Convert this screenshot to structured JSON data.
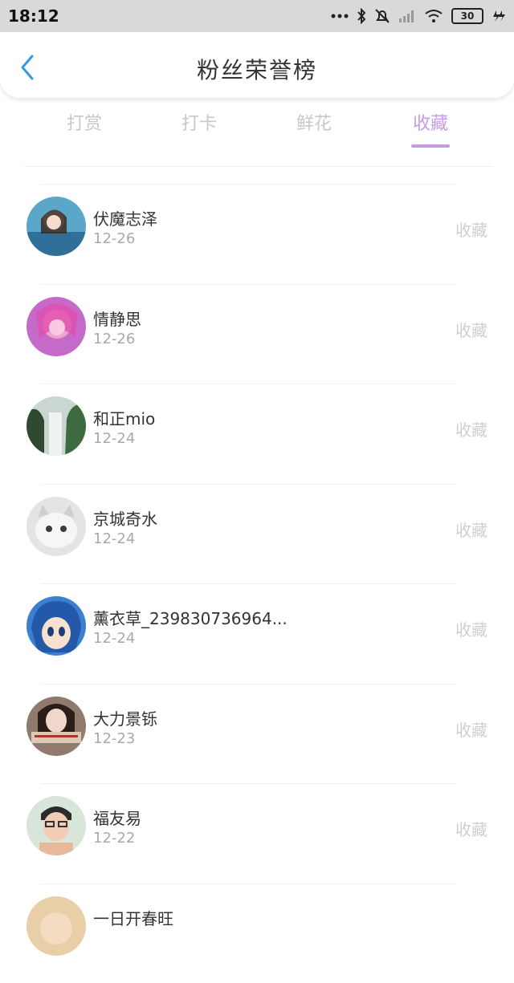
{
  "status_bar": {
    "time": "18:12",
    "battery": "30",
    "icons": [
      "more-dots-icon",
      "bluetooth-icon",
      "alarm-off-icon",
      "signal-icon",
      "wifi-icon",
      "battery-icon",
      "charging-icon"
    ]
  },
  "header": {
    "back_icon": "chevron-left-icon",
    "title": "粉丝荣誉榜"
  },
  "tabs": [
    {
      "label": "打赏",
      "active": false
    },
    {
      "label": "打卡",
      "active": false
    },
    {
      "label": "鲜花",
      "active": false
    },
    {
      "label": "收藏",
      "active": true
    }
  ],
  "colors": {
    "accent": "#c59be6",
    "back_icon": "#2f9be8",
    "inactive_tab": "#c8c8c8",
    "muted_text": "#a9a9a9"
  },
  "list": [
    {
      "name": "伏魔志泽",
      "date": "12-26",
      "action": "收藏"
    },
    {
      "name": "情静思",
      "date": "12-26",
      "action": "收藏"
    },
    {
      "name": "和正mio",
      "date": "12-24",
      "action": "收藏"
    },
    {
      "name": "京城奇水",
      "date": "12-24",
      "action": "收藏"
    },
    {
      "name": "薰衣草_239830736964...",
      "date": "12-24",
      "action": "收藏"
    },
    {
      "name": "大力景铄",
      "date": "12-23",
      "action": "收藏"
    },
    {
      "name": "福友易",
      "date": "12-22",
      "action": "收藏"
    },
    {
      "name": "一日开春旺",
      "date": "",
      "action": ""
    }
  ]
}
